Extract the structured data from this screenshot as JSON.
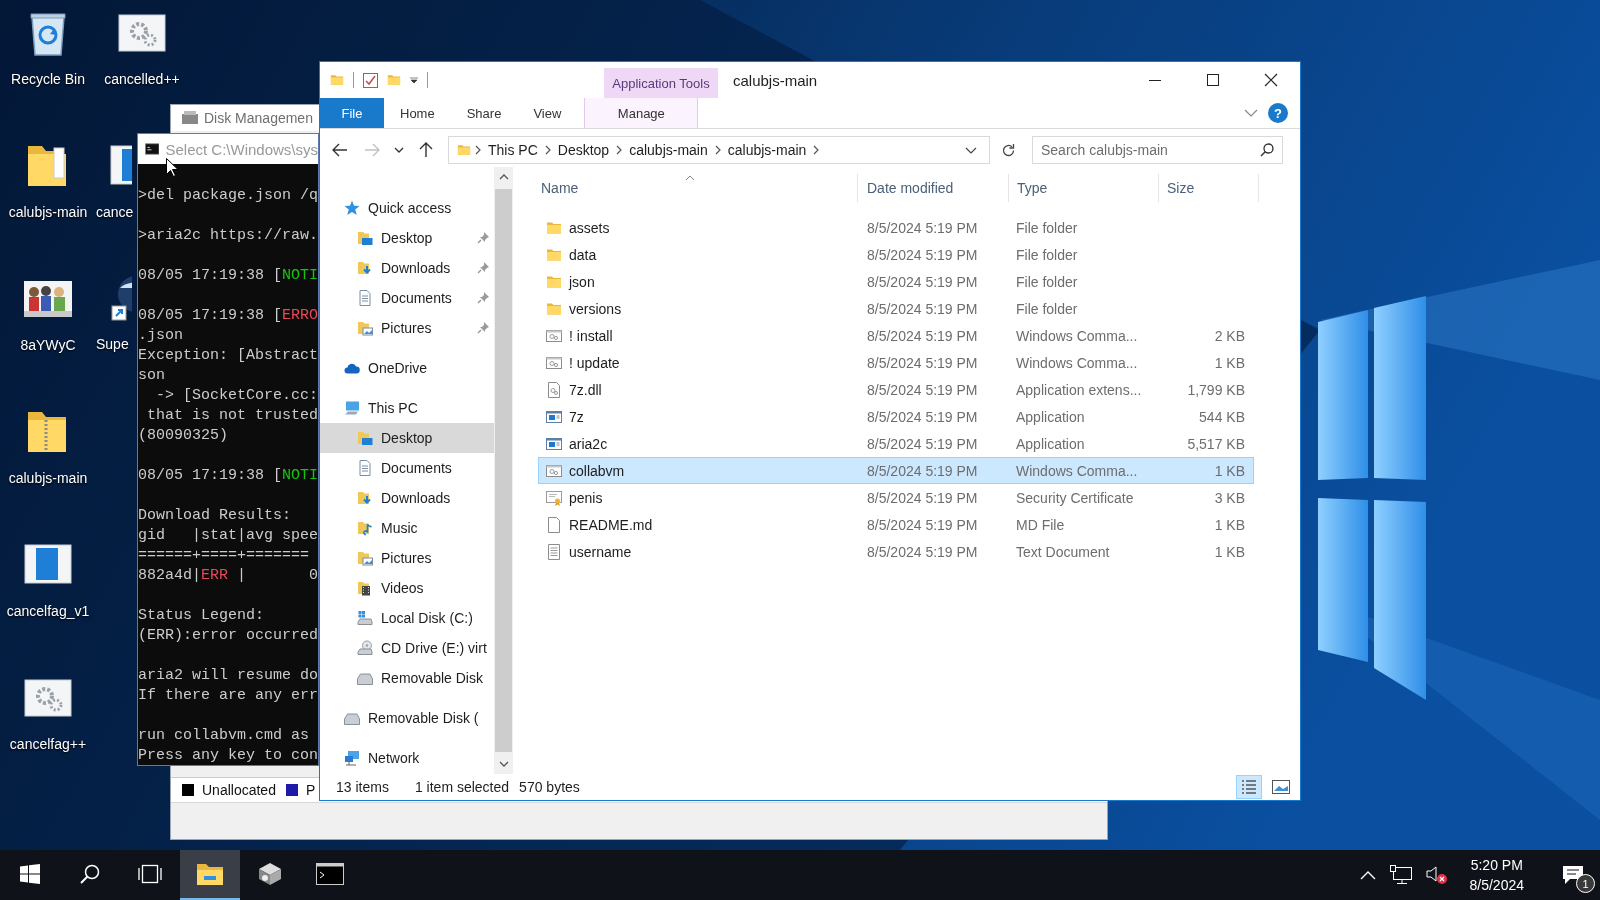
{
  "desktop": {
    "icons": [
      {
        "label": "Recycle Bin",
        "kind": "recycle-bin"
      },
      {
        "label": "cancelled++",
        "kind": "gear-window"
      },
      {
        "label": "calubjs-main",
        "kind": "folder"
      },
      {
        "label": "cance",
        "kind": "window"
      },
      {
        "label": "8aYWyC"
      },
      {
        "label": "Supe",
        "kind": "globe-shortcut"
      },
      {
        "label": "calubjs-main",
        "kind": "zip-folder"
      },
      {
        "label": "cancelfag_v1",
        "kind": "window"
      },
      {
        "label": "cancelfag++",
        "kind": "gear-window"
      }
    ]
  },
  "disk_management": {
    "title": "Disk Managemen",
    "legend": [
      {
        "label": "Unallocated",
        "color": "#000000"
      },
      {
        "label": "P",
        "color": "#1c1ca8"
      }
    ]
  },
  "console": {
    "title": "Select C:\\Windows\\sys",
    "blocks": [
      [
        [
          {
            "text": ">del package.json /q"
          }
        ]
      ],
      [
        [
          {
            "text": ">aria2c https://raw."
          }
        ]
      ],
      [
        [
          {
            "text": "08/05 17:19:38 ["
          },
          {
            "text": "NOTI",
            "kind": "notice"
          }
        ]
      ],
      [
        [
          {
            "text": "08/05 17:19:38 ["
          },
          {
            "text": "ERRO",
            "kind": "error"
          }
        ],
        [
          {
            "text": ".json"
          }
        ],
        [
          {
            "text": "Exception: [Abstract"
          }
        ],
        [
          {
            "text": "son"
          }
        ],
        [
          {
            "text": "  -> [SocketCore.cc:"
          }
        ],
        [
          {
            "text": " that is not trusted"
          }
        ],
        [
          {
            "text": "(80090325)"
          }
        ]
      ],
      [
        [
          {
            "text": "08/05 17:19:38 ["
          },
          {
            "text": "NOTI",
            "kind": "notice"
          }
        ]
      ],
      [
        [
          {
            "text": "Download Results:"
          }
        ],
        [
          {
            "text": "gid   |stat|avg spee"
          }
        ],
        [
          {
            "text": "======+====+======="
          }
        ],
        [
          {
            "text": "882a4d|"
          },
          {
            "text": "ERR",
            "kind": "error"
          },
          {
            "text": " |       0"
          }
        ]
      ],
      [
        [
          {
            "text": "Status Legend:"
          }
        ],
        [
          {
            "text": "(ERR):error occurred"
          }
        ]
      ],
      [
        [
          {
            "text": "aria2 will resume do"
          }
        ],
        [
          {
            "text": "If there are any err"
          }
        ]
      ],
      [
        [
          {
            "text": "run collabvm.cmd as"
          }
        ],
        [
          {
            "text": "Press any key to con"
          }
        ]
      ]
    ]
  },
  "explorer": {
    "title": "calubjs-main",
    "context_tab": "Application Tools",
    "ribbon_tabs": [
      {
        "label": "File",
        "kind": "file",
        "selected": false
      },
      {
        "label": "Home",
        "kind": "normal",
        "selected": false
      },
      {
        "label": "Share",
        "kind": "normal",
        "selected": false
      },
      {
        "label": "View",
        "kind": "normal",
        "selected": false
      },
      {
        "label": "Manage",
        "kind": "context",
        "selected": false
      }
    ],
    "help_glyph": "?",
    "nav_buttons": [
      {
        "kind": "back",
        "disabled": false
      },
      {
        "kind": "forward",
        "disabled": true
      },
      {
        "kind": "recent",
        "disabled": false
      },
      {
        "kind": "up",
        "disabled": false
      }
    ],
    "breadcrumb": [
      "This PC",
      "Desktop",
      "calubjs-main",
      "calubjs-main"
    ],
    "search": {
      "placeholder": "Search calubjs-main"
    },
    "nav": [
      {
        "label": "Quick access",
        "kind": "star",
        "selected": false,
        "children": [
          {
            "label": "Desktop",
            "kind": "desktop",
            "pinned": true,
            "selected": false
          },
          {
            "label": "Downloads",
            "kind": "downloads",
            "pinned": true,
            "selected": false
          },
          {
            "label": "Documents",
            "kind": "documents",
            "pinned": true,
            "selected": false
          },
          {
            "label": "Pictures",
            "kind": "pictures",
            "pinned": true,
            "selected": false
          }
        ]
      },
      {
        "label": "OneDrive",
        "kind": "cloud",
        "selected": false
      },
      {
        "label": "This PC",
        "kind": "pc",
        "selected": false,
        "children": [
          {
            "label": "Desktop",
            "kind": "desktop",
            "pinned": false,
            "selected": true
          },
          {
            "label": "Documents",
            "kind": "documents",
            "pinned": false,
            "selected": false
          },
          {
            "label": "Downloads",
            "kind": "downloads",
            "pinned": false,
            "selected": false
          },
          {
            "label": "Music",
            "kind": "music",
            "pinned": false,
            "selected": false
          },
          {
            "label": "Pictures",
            "kind": "pictures",
            "pinned": false,
            "selected": false
          },
          {
            "label": "Videos",
            "kind": "videos",
            "pinned": false,
            "selected": false
          },
          {
            "label": "Local Disk (C:)",
            "kind": "disk",
            "pinned": false,
            "selected": false
          },
          {
            "label": "CD Drive (E:) virt",
            "kind": "cd",
            "pinned": false,
            "selected": false
          },
          {
            "label": "Removable Disk",
            "kind": "removable",
            "pinned": false,
            "selected": false
          }
        ]
      },
      {
        "label": "Removable Disk (",
        "kind": "removable",
        "selected": false
      },
      {
        "label": "Network",
        "kind": "network",
        "selected": false
      }
    ],
    "columns": [
      {
        "label": "Name",
        "sorted": true
      },
      {
        "label": "Date modified",
        "sorted": false
      },
      {
        "label": "Type",
        "sorted": false
      },
      {
        "label": "Size",
        "sorted": false
      }
    ],
    "files": [
      {
        "name": "assets",
        "date": "8/5/2024 5:19 PM",
        "type": "File folder",
        "kind": "folder",
        "selected": false
      },
      {
        "name": "data",
        "date": "8/5/2024 5:19 PM",
        "type": "File folder",
        "kind": "folder",
        "selected": false
      },
      {
        "name": "json",
        "date": "8/5/2024 5:19 PM",
        "type": "File folder",
        "kind": "folder",
        "selected": false
      },
      {
        "name": "versions",
        "date": "8/5/2024 5:19 PM",
        "type": "File folder",
        "kind": "folder",
        "selected": false
      },
      {
        "name": "! install",
        "date": "8/5/2024 5:19 PM",
        "type": "Windows Comma...",
        "size": "2 KB",
        "kind": "script",
        "selected": false
      },
      {
        "name": "! update",
        "date": "8/5/2024 5:19 PM",
        "type": "Windows Comma...",
        "size": "1 KB",
        "kind": "script",
        "selected": false
      },
      {
        "name": "7z.dll",
        "date": "8/5/2024 5:19 PM",
        "type": "Application extens...",
        "size": "1,799 KB",
        "kind": "dll",
        "selected": false
      },
      {
        "name": "7z",
        "date": "8/5/2024 5:19 PM",
        "type": "Application",
        "size": "544 KB",
        "kind": "app",
        "selected": false
      },
      {
        "name": "aria2c",
        "date": "8/5/2024 5:19 PM",
        "type": "Application",
        "size": "5,517 KB",
        "kind": "app",
        "selected": false
      },
      {
        "name": "collabvm",
        "date": "8/5/2024 5:19 PM",
        "type": "Windows Comma...",
        "size": "1 KB",
        "kind": "script",
        "selected": true
      },
      {
        "name": "penis",
        "date": "8/5/2024 5:19 PM",
        "type": "Security Certificate",
        "size": "3 KB",
        "kind": "cert",
        "selected": false
      },
      {
        "name": "README.md",
        "date": "8/5/2024 5:19 PM",
        "type": "MD File",
        "size": "1 KB",
        "kind": "blank",
        "selected": false
      },
      {
        "name": "username",
        "date": "8/5/2024 5:19 PM",
        "type": "Text Document",
        "size": "1 KB",
        "kind": "text",
        "selected": false
      }
    ],
    "status": {
      "count": "13 items",
      "selection": "1 item selected",
      "size": "570 bytes"
    },
    "views": [
      {
        "kind": "details",
        "selected": true
      },
      {
        "kind": "large-icons",
        "selected": false
      }
    ]
  },
  "taskbar": {
    "buttons": [
      {
        "kind": "start",
        "active": false
      },
      {
        "kind": "search",
        "active": false
      },
      {
        "kind": "task-view",
        "active": false
      },
      {
        "kind": "explorer",
        "active": true
      },
      {
        "kind": "disk-tool",
        "active": false
      },
      {
        "kind": "console",
        "active": false
      }
    ],
    "time": "5:20 PM",
    "date": "8/5/2024",
    "notifications": "1"
  }
}
